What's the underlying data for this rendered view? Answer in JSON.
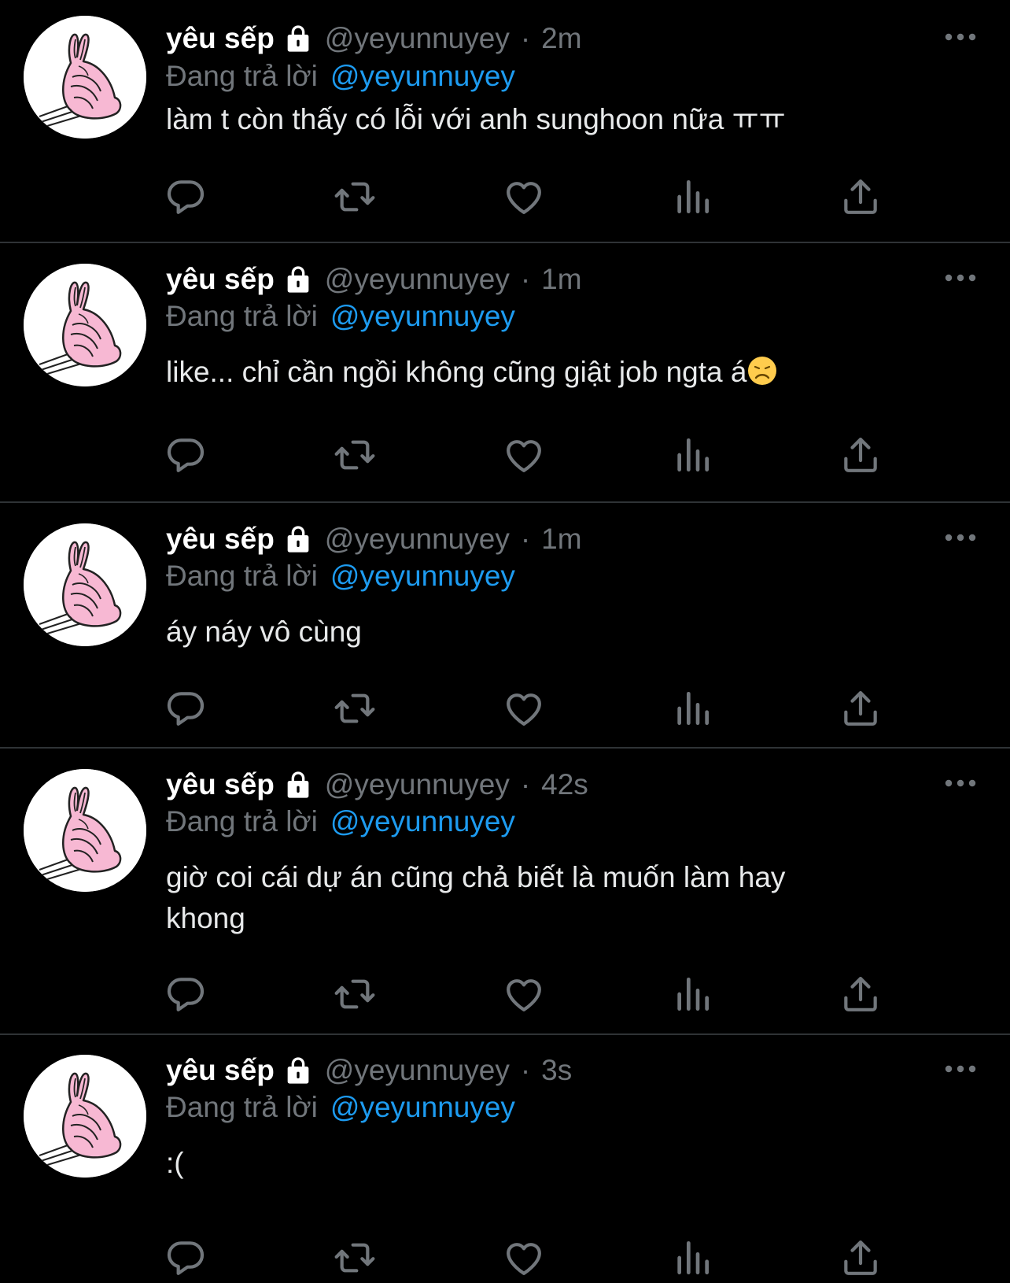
{
  "colors": {
    "background": "#000000",
    "text_primary": "#e7e9ea",
    "text_secondary": "#71767b",
    "link_blue": "#1d9bf0",
    "divider": "#2f3336",
    "avatar_bunny_pink": "#f7b8d3"
  },
  "icons": {
    "lock": "lock-icon",
    "more": "more-horizontal-icon",
    "reply": "reply-bubble-icon",
    "retweet": "retweet-icon",
    "like": "heart-icon",
    "views": "views-bar-chart-icon",
    "share": "share-upload-icon",
    "avatar": "pink-bunny-avatar"
  },
  "tweets": [
    {
      "display_name": "yêu sếp",
      "handle": "@yeyunnuyey",
      "separator": "·",
      "time": "2m",
      "reply_prefix": "Đang trả lời",
      "reply_to": "@yeyunnuyey",
      "text": "làm t còn thấy có lỗi với anh sunghoon nữa ㅠㅠ"
    },
    {
      "display_name": "yêu sếp",
      "handle": "@yeyunnuyey",
      "separator": "·",
      "time": "1m",
      "reply_prefix": "Đang trả lời",
      "reply_to": "@yeyunnuyey",
      "text": "like... chỉ cần ngồi không cũng giật job ngta á",
      "emoji": "disappointed-face-emoji"
    },
    {
      "display_name": "yêu sếp",
      "handle": "@yeyunnuyey",
      "separator": "·",
      "time": "1m",
      "reply_prefix": "Đang trả lời",
      "reply_to": "@yeyunnuyey",
      "text": "áy náy vô cùng"
    },
    {
      "display_name": "yêu sếp",
      "handle": "@yeyunnuyey",
      "separator": "·",
      "time": "42s",
      "reply_prefix": "Đang trả lời",
      "reply_to": "@yeyunnuyey",
      "text": "giờ coi cái dự án cũng chả biết là muốn làm hay\nkhong"
    },
    {
      "display_name": "yêu sếp",
      "handle": "@yeyunnuyey",
      "separator": "·",
      "time": "3s",
      "reply_prefix": "Đang trả lời",
      "reply_to": "@yeyunnuyey",
      "text": ":("
    }
  ]
}
